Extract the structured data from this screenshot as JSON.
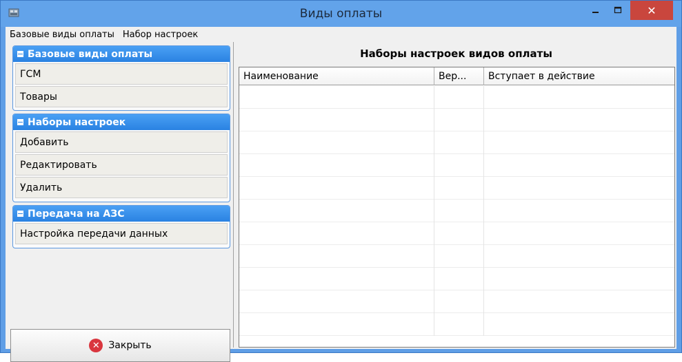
{
  "window": {
    "title": "Виды оплаты",
    "min_glyph": "–",
    "max_glyph": "☐",
    "close_glyph": "✕"
  },
  "menu": [
    "Базовые виды оплаты",
    "Набор настроек"
  ],
  "groups": [
    {
      "title": "Базовые виды оплаты",
      "items": [
        "ГСМ",
        "Товары"
      ]
    },
    {
      "title": "Наборы настроек",
      "items": [
        "Добавить",
        "Редактировать",
        "Удалить"
      ]
    },
    {
      "title": "Передача на АЗС",
      "items": [
        "Настройка передачи данных"
      ]
    }
  ],
  "close_button": {
    "label": "Закрыть",
    "icon": "close-circle-icon"
  },
  "table": {
    "title": "Наборы настроек видов оплаты",
    "columns": [
      "Наименование",
      "Вер...",
      "Вступает в действие"
    ],
    "rows": []
  },
  "colors": {
    "titlebar": "#62a3ea",
    "group_header": "#2a82e2",
    "close_red": "#c9463d"
  }
}
